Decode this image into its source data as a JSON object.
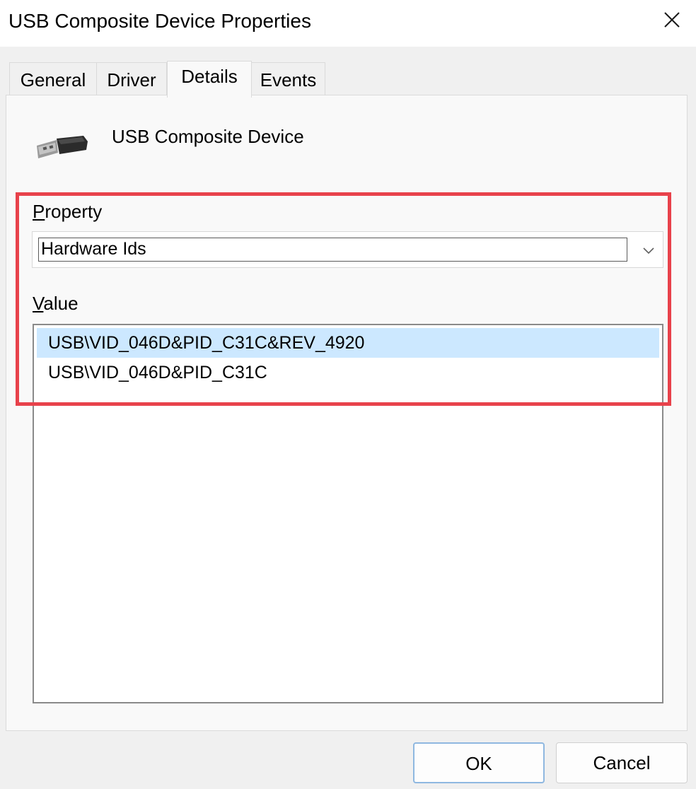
{
  "window": {
    "title": "USB Composite Device Properties",
    "close_icon": "close-icon"
  },
  "tabs": [
    {
      "label": "General",
      "active": false
    },
    {
      "label": "Driver",
      "active": false
    },
    {
      "label": "Details",
      "active": true
    },
    {
      "label": "Events",
      "active": false
    }
  ],
  "device": {
    "icon": "usb-plug-icon",
    "name": "USB Composite Device"
  },
  "property": {
    "label_first": "P",
    "label_rest": "roperty",
    "selected": "Hardware Ids",
    "arrow_icon": "chevron-down-icon"
  },
  "value": {
    "label_first": "V",
    "label_rest": "alue",
    "items": [
      "USB\\VID_046D&PID_C31C&REV_4920",
      "USB\\VID_046D&PID_C31C"
    ],
    "selected_index": 0
  },
  "buttons": {
    "ok": "OK",
    "cancel": "Cancel"
  },
  "colors": {
    "highlight_border": "#e8424b",
    "selection": "#cce8ff"
  }
}
